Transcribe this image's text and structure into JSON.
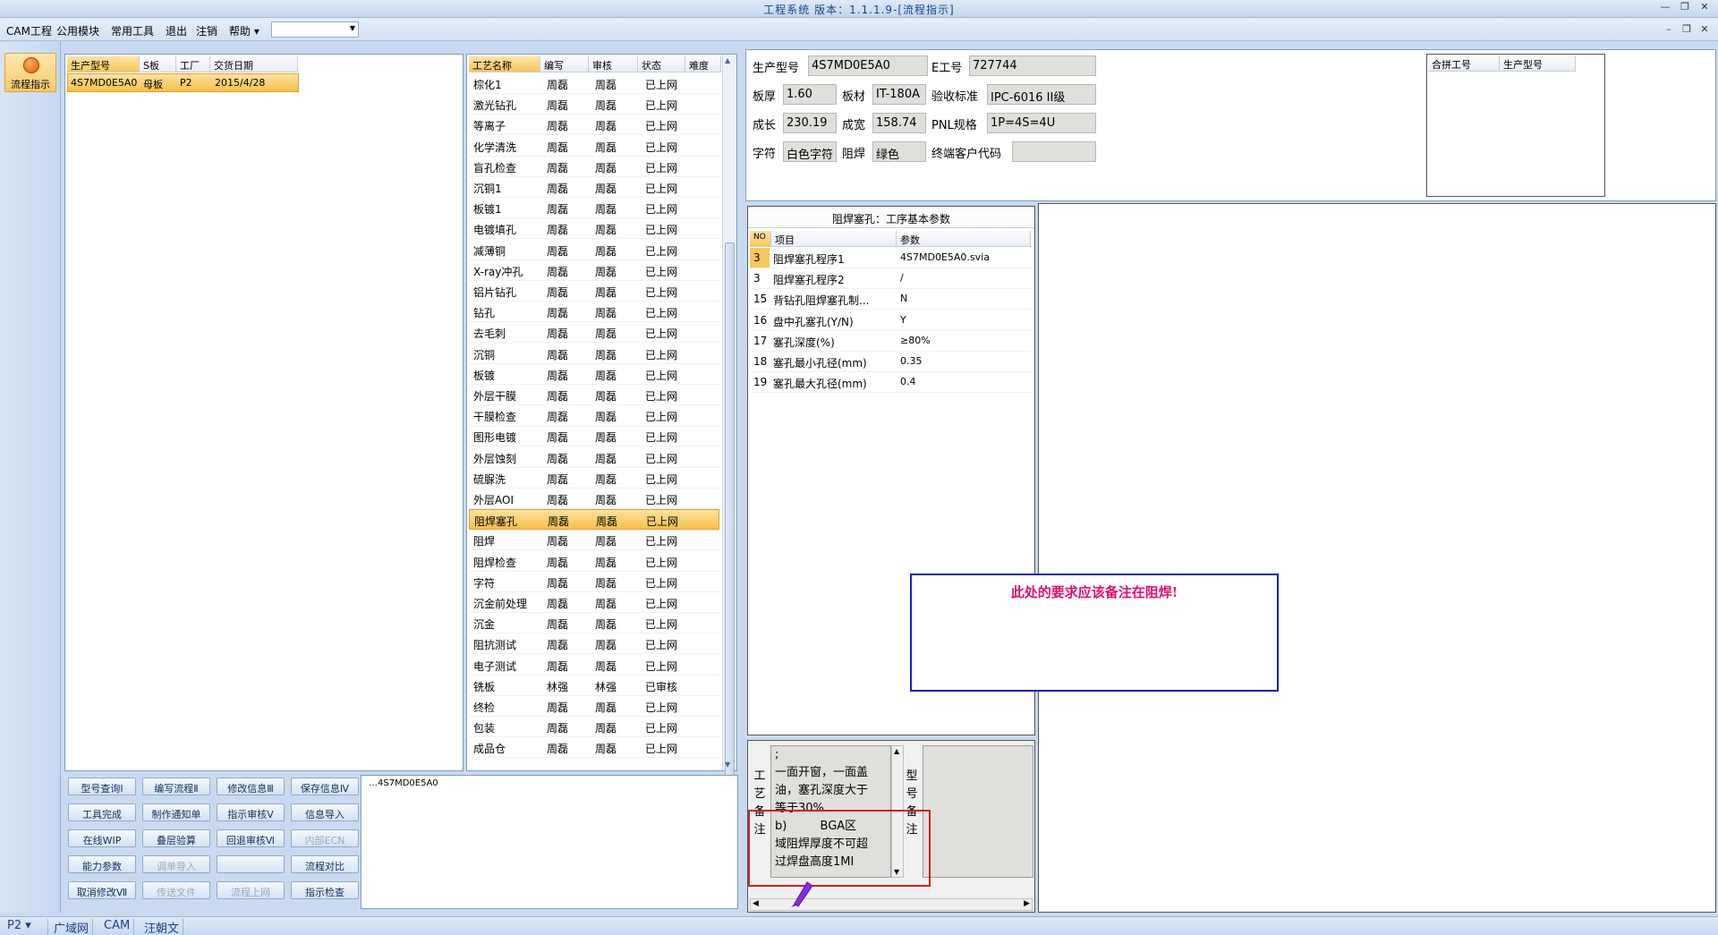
{
  "window": {
    "title": "工程系统 版本：1.1.1.9-[流程指示]"
  },
  "menu": {
    "items": [
      "CAM工程",
      "公用模块",
      "常用工具",
      "退出",
      "注销",
      "帮助 ▾"
    ]
  },
  "nav": {
    "button_label": "流程指示"
  },
  "orders": {
    "headers": [
      "生产型号",
      "S板",
      "工厂",
      "交货日期"
    ],
    "rows": [
      {
        "model": "4S7MD0E5A0",
        "board": "母板",
        "plant": "P2",
        "date": "2015/4/28"
      }
    ]
  },
  "process": {
    "headers": [
      "工艺名称",
      "编写",
      "审核",
      "状态",
      "难度"
    ],
    "rows": [
      [
        "棕化1",
        "周磊",
        "周磊",
        "已上网"
      ],
      [
        "激光钻孔",
        "周磊",
        "周磊",
        "已上网"
      ],
      [
        "等离子",
        "周磊",
        "周磊",
        "已上网"
      ],
      [
        "化学清洗",
        "周磊",
        "周磊",
        "已上网"
      ],
      [
        "盲孔检查",
        "周磊",
        "周磊",
        "已上网"
      ],
      [
        "沉铜1",
        "周磊",
        "周磊",
        "已上网"
      ],
      [
        "板镀1",
        "周磊",
        "周磊",
        "已上网"
      ],
      [
        "电镀填孔",
        "周磊",
        "周磊",
        "已上网"
      ],
      [
        "减薄铜",
        "周磊",
        "周磊",
        "已上网"
      ],
      [
        "X-ray冲孔",
        "周磊",
        "周磊",
        "已上网"
      ],
      [
        "铝片钻孔",
        "周磊",
        "周磊",
        "已上网"
      ],
      [
        "钻孔",
        "周磊",
        "周磊",
        "已上网"
      ],
      [
        "去毛刺",
        "周磊",
        "周磊",
        "已上网"
      ],
      [
        "沉铜",
        "周磊",
        "周磊",
        "已上网"
      ],
      [
        "板镀",
        "周磊",
        "周磊",
        "已上网"
      ],
      [
        "外层干膜",
        "周磊",
        "周磊",
        "已上网"
      ],
      [
        "干膜检查",
        "周磊",
        "周磊",
        "已上网"
      ],
      [
        "图形电镀",
        "周磊",
        "周磊",
        "已上网"
      ],
      [
        "外层蚀刻",
        "周磊",
        "周磊",
        "已上网"
      ],
      [
        "硫脲洗",
        "周磊",
        "周磊",
        "已上网"
      ],
      [
        "外层AOI",
        "周磊",
        "周磊",
        "已上网"
      ],
      [
        "阻焊塞孔",
        "周磊",
        "周磊",
        "已上网"
      ],
      [
        "阻焊",
        "周磊",
        "周磊",
        "已上网"
      ],
      [
        "阻焊检查",
        "周磊",
        "周磊",
        "已上网"
      ],
      [
        "字符",
        "周磊",
        "周磊",
        "已上网"
      ],
      [
        "沉金前处理",
        "周磊",
        "周磊",
        "已上网"
      ],
      [
        "沉金",
        "周磊",
        "周磊",
        "已上网"
      ],
      [
        "阻抗测试",
        "周磊",
        "周磊",
        "已上网"
      ],
      [
        "电子测试",
        "周磊",
        "周磊",
        "已上网"
      ],
      [
        "铣板",
        "林强",
        "林强",
        "已审核"
      ],
      [
        "终检",
        "周磊",
        "周磊",
        "已上网"
      ],
      [
        "包装",
        "周磊",
        "周磊",
        "已上网"
      ],
      [
        "成品仓",
        "周磊",
        "周磊",
        "已上网"
      ]
    ],
    "selected_index": 21
  },
  "buttons": [
    [
      "型号查询Ⅰ",
      "编写流程Ⅱ",
      "修改信息Ⅲ",
      "保存信息Ⅳ"
    ],
    [
      "工具完成",
      "制作通知单",
      "指示审核Ⅴ",
      "信息导入"
    ],
    [
      "在线WIP",
      "叠层验算",
      "回退审核Ⅵ",
      "内部ECN"
    ],
    [
      "能力参数",
      "调单导入",
      "",
      "流程对比"
    ],
    [
      "取消修改Ⅶ",
      "传送文件",
      "流程上网",
      "指示检查"
    ]
  ],
  "tree": {
    "item": "4S7MD0E5A0"
  },
  "info": {
    "labels": {
      "model": "生产型号",
      "e_no": "E工号",
      "thickness": "板厚",
      "material": "板材",
      "standard": "验收标准",
      "length": "成长",
      "width": "成宽",
      "pnl": "PNL规格",
      "char": "字符",
      "mask": "阻焊",
      "customer": "终端客户代码"
    },
    "values": {
      "model": "4S7MD0E5A0",
      "e_no": "727744",
      "thickness": "1.60",
      "material": "IT-180A",
      "standard": "IPC-6016 II级",
      "length": "230.19",
      "width": "158.74",
      "pnl": "1P=4S=4U",
      "char": "白色字符",
      "mask": "绿色",
      "customer": ""
    }
  },
  "merge": {
    "headers": [
      "合拼工号",
      "生产型号"
    ]
  },
  "params": {
    "title": "阻焊塞孔：工序基本参数",
    "headers": [
      "NO",
      "项目",
      "参数"
    ],
    "rows": [
      [
        "3",
        "阻焊塞孔程序1",
        "4S7MD0E5A0.svia"
      ],
      [
        "3",
        "阻焊塞孔程序2",
        "/"
      ],
      [
        "15",
        "背钻孔阻焊塞孔制...",
        "N"
      ],
      [
        "16",
        "盘中孔塞孔(Y/N)",
        "Y"
      ],
      [
        "17",
        "塞孔深度(%)",
        "≥80%"
      ],
      [
        "18",
        "塞孔最小孔径(mm)",
        "0.35"
      ],
      [
        "19",
        "塞孔最大孔径(mm)",
        "0.4"
      ]
    ]
  },
  "annotation": {
    "text": "此处的要求应该备注在阻焊!"
  },
  "remarks": {
    "process_label": [
      "工",
      "艺",
      "备",
      "注"
    ],
    "model_label": [
      "型",
      "号",
      "备",
      "注"
    ],
    "lines": [
      ";",
      "一面开窗，一面盖",
      "油，塞孔深度大于",
      "等于30%",
      "b)         BGA区",
      "域阻焊厚度不可超",
      "过焊盘高度1MI"
    ]
  },
  "statusbar": {
    "items": [
      "P2 ▾",
      "广域网",
      "CAM",
      "汪朝文"
    ]
  },
  "colors": {
    "selected_row": "#f6c049",
    "annotation_text": "#e0106a",
    "annotation_border": "#1b1bb5",
    "highlight_box": "#d02020"
  }
}
